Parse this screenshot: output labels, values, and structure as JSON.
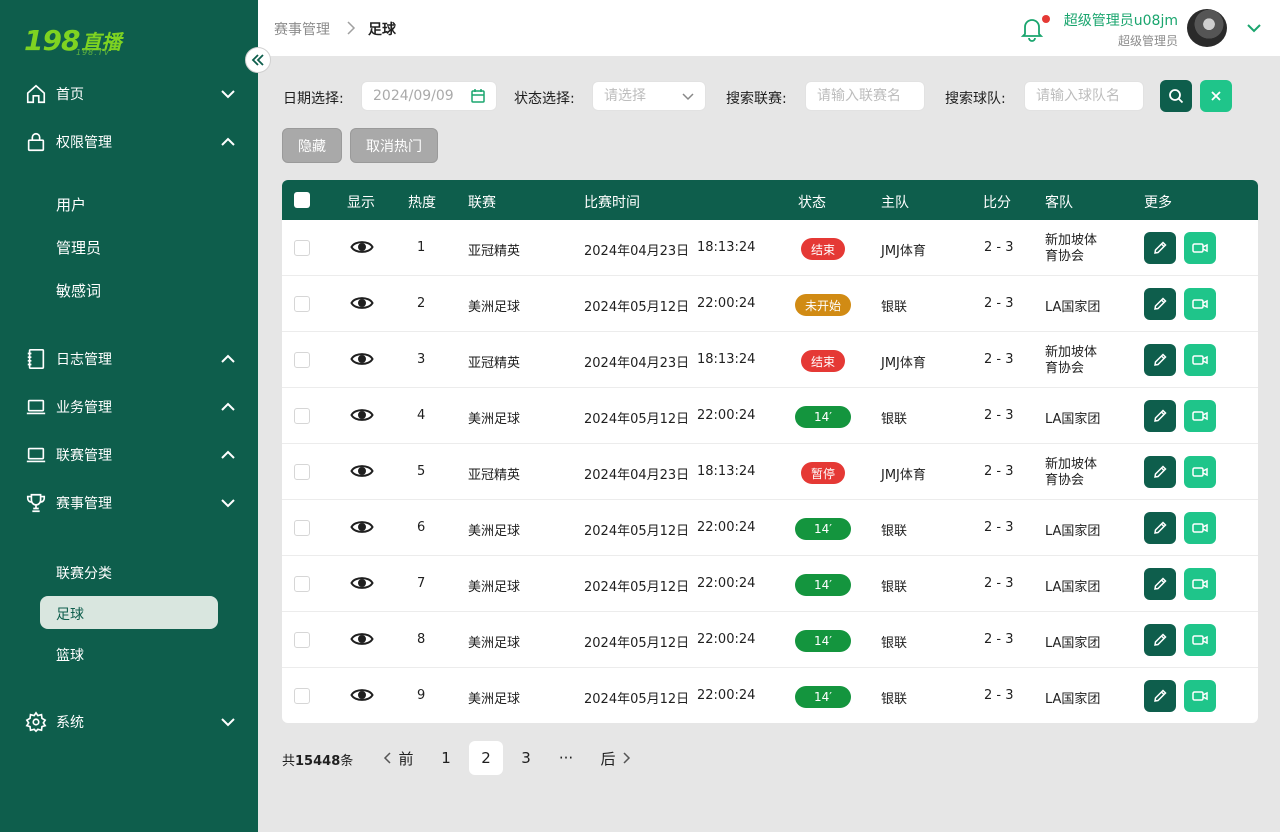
{
  "brand": {
    "logo_num": "198",
    "logo_text": "直播",
    "logo_sub": "198.TV"
  },
  "sidebar": {
    "items": [
      {
        "label": "首页",
        "icon": "home-icon",
        "expanded": false
      },
      {
        "label": "权限管理",
        "icon": "lock-icon",
        "expanded": true,
        "children": [
          "用户",
          "管理员",
          "敏感词"
        ]
      },
      {
        "label": "日志管理",
        "icon": "notebook-icon",
        "expanded": true
      },
      {
        "label": "业务管理",
        "icon": "laptop-icon",
        "expanded": true
      },
      {
        "label": "联赛管理",
        "icon": "laptop-icon",
        "expanded": true
      },
      {
        "label": "赛事管理",
        "icon": "trophy-icon",
        "expanded": false,
        "children": [
          "联赛分类",
          "足球",
          "篮球"
        ],
        "active_child": "足球"
      },
      {
        "label": "系统",
        "icon": "gear-icon",
        "expanded": false
      }
    ]
  },
  "header": {
    "breadcrumb": [
      "赛事管理",
      "足球"
    ],
    "user_name": "超级管理员u08jm",
    "user_role": "超级管理员"
  },
  "filters": {
    "date_label": "日期选择:",
    "date_value": "2024/09/09",
    "status_label": "状态选择:",
    "status_placeholder": "请选择",
    "league_label": "搜索联赛:",
    "league_placeholder": "请输入联赛名",
    "team_label": "搜索球队:",
    "team_placeholder": "请输入球队名",
    "hide_button": "隐藏",
    "unhot_button": "取消热门"
  },
  "table": {
    "columns": [
      "显示",
      "热度",
      "联赛",
      "比赛时间",
      "状态",
      "主队",
      "比分",
      "客队",
      "更多"
    ],
    "rows": [
      {
        "heat": "1",
        "league": "亚冠精英",
        "date": "2024年04月23日",
        "time": "18:13:24",
        "status": "结束",
        "status_color": "#e53935",
        "home": "JMJ体育",
        "score": "2 - 3",
        "away": [
          "新加坡体",
          "育协会"
        ]
      },
      {
        "heat": "2",
        "league": "美洲足球",
        "date": "2024年05月12日",
        "time": "22:00:24",
        "status": "未开始",
        "status_color": "#d18b14",
        "home": "银联",
        "score": "2 - 3",
        "away": [
          "LA国家团"
        ]
      },
      {
        "heat": "3",
        "league": "亚冠精英",
        "date": "2024年04月23日",
        "time": "18:13:24",
        "status": "结束",
        "status_color": "#e53935",
        "home": "JMJ体育",
        "score": "2 - 3",
        "away": [
          "新加坡体",
          "育协会"
        ]
      },
      {
        "heat": "4",
        "league": "美洲足球",
        "date": "2024年05月12日",
        "time": "22:00:24",
        "status": "14′",
        "status_color": "#14953e",
        "home": "银联",
        "score": "2 - 3",
        "away": [
          "LA国家团"
        ]
      },
      {
        "heat": "5",
        "league": "亚冠精英",
        "date": "2024年04月23日",
        "time": "18:13:24",
        "status": "暂停",
        "status_color": "#e53935",
        "home": "JMJ体育",
        "score": "2 - 3",
        "away": [
          "新加坡体",
          "育协会"
        ]
      },
      {
        "heat": "6",
        "league": "美洲足球",
        "date": "2024年05月12日",
        "time": "22:00:24",
        "status": "14′",
        "status_color": "#14953e",
        "home": "银联",
        "score": "2 - 3",
        "away": [
          "LA国家团"
        ]
      },
      {
        "heat": "7",
        "league": "美洲足球",
        "date": "2024年05月12日",
        "time": "22:00:24",
        "status": "14′",
        "status_color": "#14953e",
        "home": "银联",
        "score": "2 - 3",
        "away": [
          "LA国家团"
        ]
      },
      {
        "heat": "8",
        "league": "美洲足球",
        "date": "2024年05月12日",
        "time": "22:00:24",
        "status": "14′",
        "status_color": "#14953e",
        "home": "银联",
        "score": "2 - 3",
        "away": [
          "LA国家团"
        ]
      },
      {
        "heat": "9",
        "league": "美洲足球",
        "date": "2024年05月12日",
        "time": "22:00:24",
        "status": "14′",
        "status_color": "#14953e",
        "home": "银联",
        "score": "2 - 3",
        "away": [
          "LA国家团"
        ]
      }
    ]
  },
  "pagination": {
    "total_prefix": "共",
    "total_count": "15448",
    "total_suffix": "条",
    "prev": "前",
    "next": "后",
    "pages": [
      "1",
      "2",
      "3",
      "···"
    ],
    "current": "2"
  },
  "colors": {
    "primary": "#0e5e4c",
    "accent": "#1fc58a",
    "sidebar_active": "#d9e6df"
  }
}
